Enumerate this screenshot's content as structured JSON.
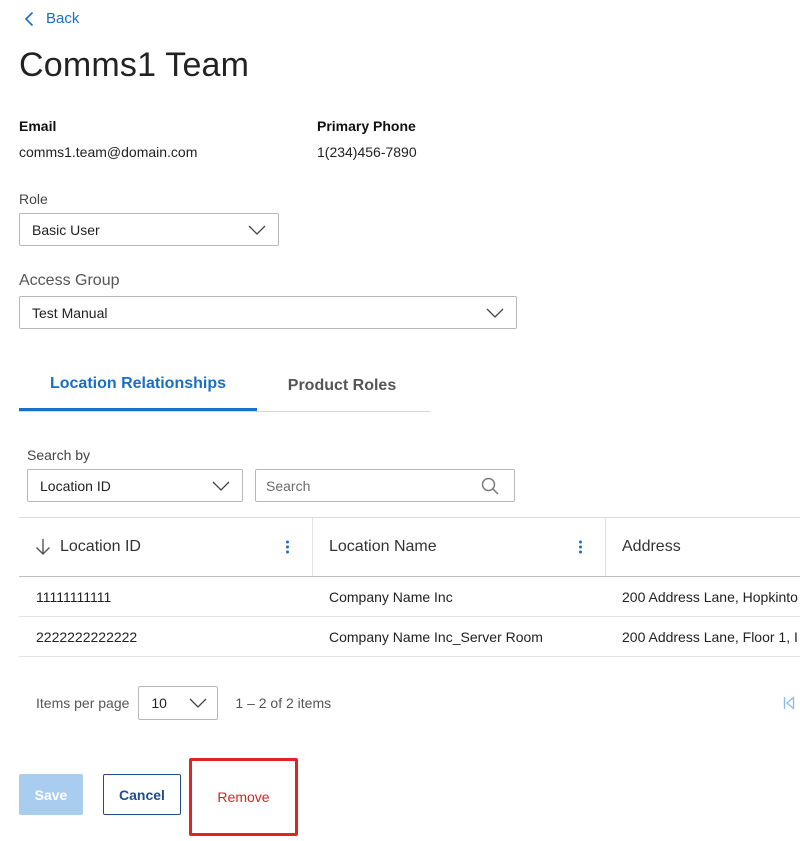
{
  "nav": {
    "back_label": "Back"
  },
  "page": {
    "title": "Comms1 Team"
  },
  "contact": {
    "email_label": "Email",
    "email_value": "comms1.team@domain.com",
    "phone_label": "Primary Phone",
    "phone_value": "1(234)456-7890"
  },
  "role": {
    "label": "Role",
    "value": "Basic User"
  },
  "access_group": {
    "label": "Access Group",
    "value": "Test Manual"
  },
  "tabs": [
    {
      "label": "Location Relationships",
      "active": true
    },
    {
      "label": "Product Roles",
      "active": false
    }
  ],
  "search": {
    "by_label": "Search by",
    "by_value": "Location ID",
    "placeholder": "Search",
    "value": ""
  },
  "table": {
    "columns": [
      "Location ID",
      "Location Name",
      "Address"
    ],
    "rows": [
      [
        "11111111111",
        "Company Name Inc",
        "200 Address Lane, Hopkinto"
      ],
      [
        "2222222222222",
        "Company Name Inc_Server Room",
        "200 Address Lane, Floor 1, I"
      ]
    ]
  },
  "pagination": {
    "items_per_page_label": "Items per page",
    "page_size": "10",
    "range_text": "1 – 2 of 2 items"
  },
  "actions": {
    "save": "Save",
    "cancel": "Cancel",
    "remove": "Remove"
  },
  "colors": {
    "accent": "#1a6fc4",
    "save_disabled": "#a9cdee",
    "remove_highlight": "#e02424"
  }
}
